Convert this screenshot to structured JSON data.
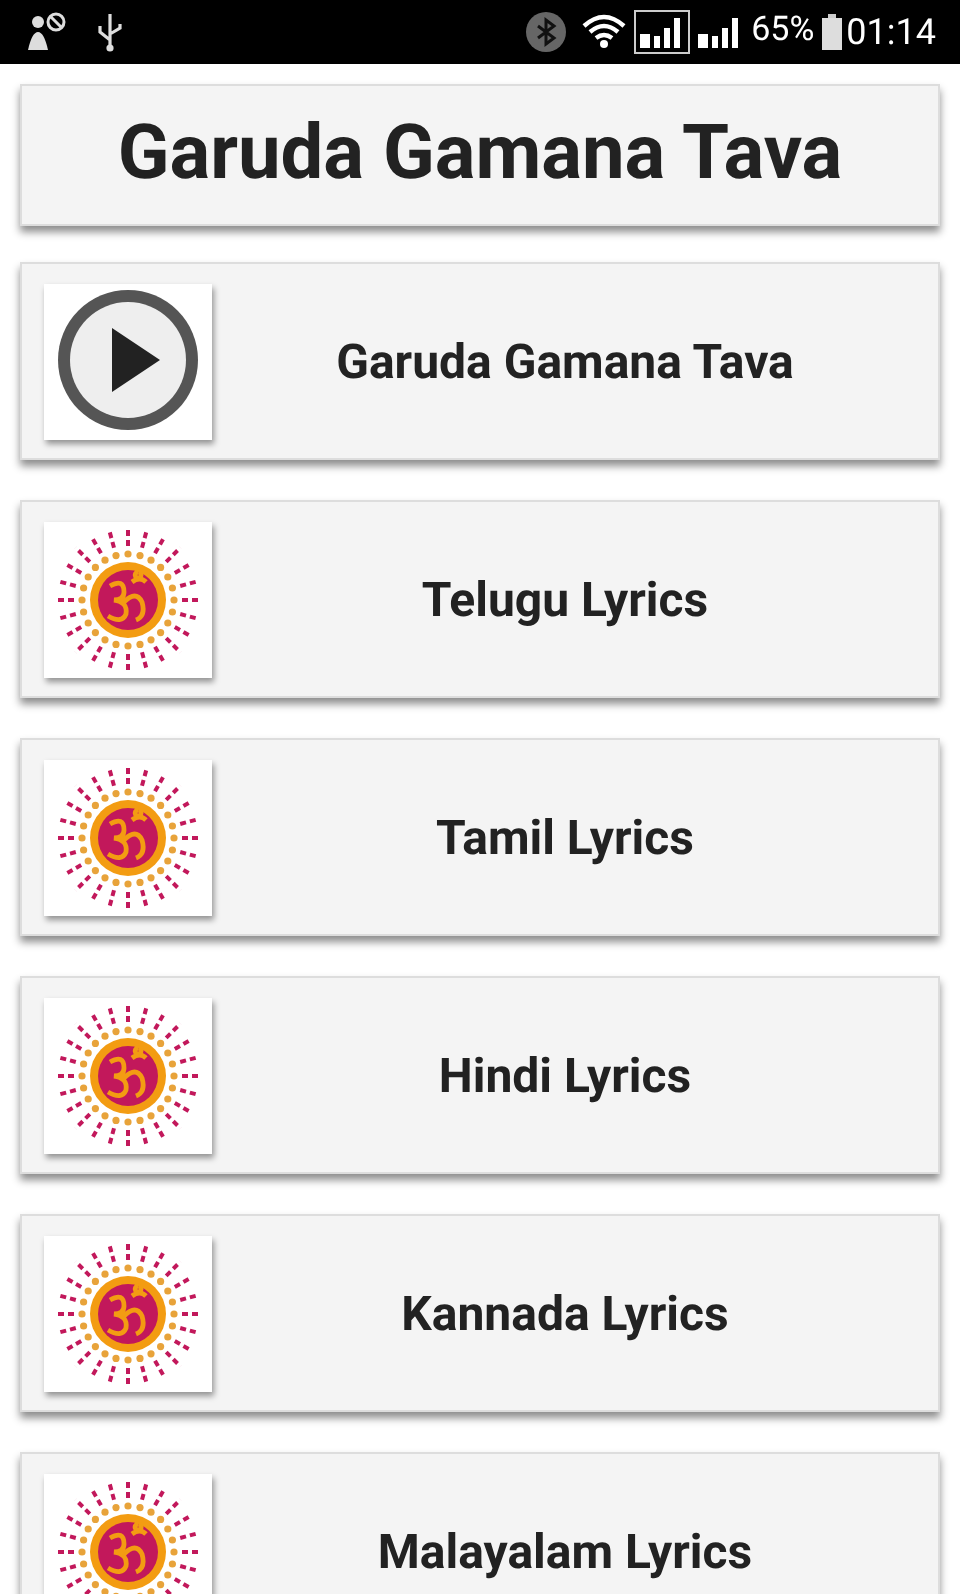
{
  "status_bar": {
    "battery": "65%",
    "time": "01:14"
  },
  "title": "Garuda Gamana Tava",
  "items": [
    {
      "label": "Garuda Gamana Tava",
      "kind": "play"
    },
    {
      "label": "Telugu Lyrics",
      "kind": "om"
    },
    {
      "label": "Tamil Lyrics",
      "kind": "om"
    },
    {
      "label": "Hindi Lyrics",
      "kind": "om"
    },
    {
      "label": "Kannada Lyrics",
      "kind": "om"
    },
    {
      "label": "Malayalam Lyrics",
      "kind": "om"
    }
  ]
}
